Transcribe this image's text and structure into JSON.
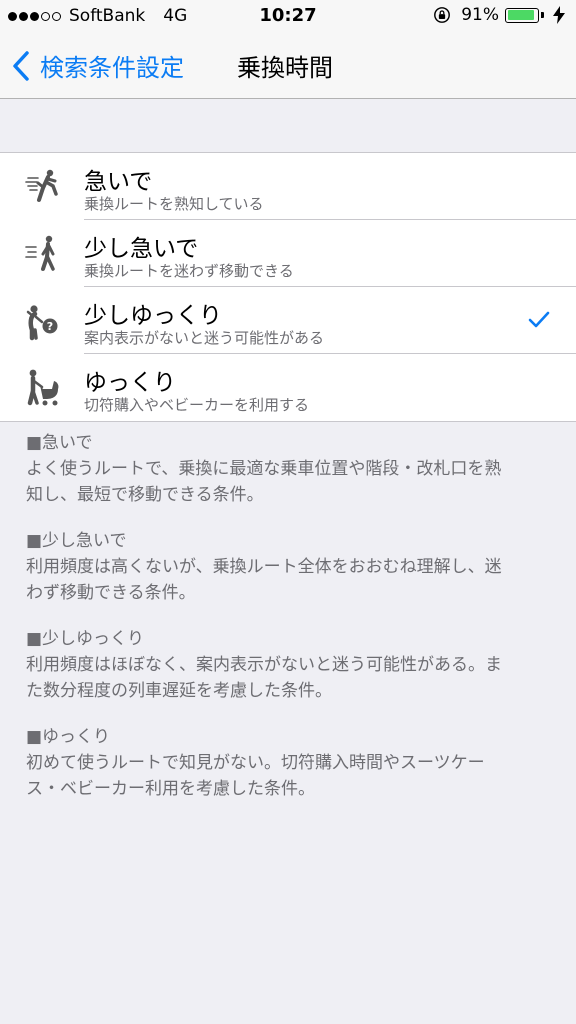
{
  "status_bar": {
    "carrier": "SoftBank",
    "network": "4G",
    "time": "10:27",
    "battery": "91%",
    "battery_level": 0.91,
    "signal_bars": 3,
    "signal_total": 5,
    "battery_color": "#4cd964"
  },
  "nav": {
    "back_label": "検索条件設定",
    "title": "乗換時間",
    "accent_color": "#0b7cf4"
  },
  "options": [
    {
      "title": "急いで",
      "desc": "乗換ルートを熟知している",
      "icon": "running-person-icon",
      "selected": false
    },
    {
      "title": "少し急いで",
      "desc": "乗換ルートを迷わず移動できる",
      "icon": "walking-person-icon",
      "selected": false
    },
    {
      "title": "少しゆっくり",
      "desc": "案内表示がないと迷う可能性がある",
      "icon": "confused-person-icon",
      "selected": true
    },
    {
      "title": "ゆっくり",
      "desc": "切符購入やベビーカーを利用する",
      "icon": "person-with-stroller-icon",
      "selected": false
    }
  ],
  "descriptions": [
    {
      "head": "■急いで",
      "lines": [
        "よく使うルートで、乗換に最適な乗車位置や階段・改札口を熟",
        "知し、最短で移動できる条件。"
      ]
    },
    {
      "head": "■少し急いで",
      "lines": [
        "利用頻度は高くないが、乗換ルート全体をおおむね理解し、迷",
        "わず移動できる条件。"
      ]
    },
    {
      "head": "■少しゆっくり",
      "lines": [
        "利用頻度はほぼなく、案内表示がないと迷う可能性がある。ま",
        "た数分程度の列車遅延を考慮した条件。"
      ]
    },
    {
      "head": "■ゆっくり",
      "lines": [
        "初めて使うルートで知見がない。切符購入時間やスーツケー",
        "ス・ベビーカー利用を考慮した条件。"
      ]
    }
  ]
}
